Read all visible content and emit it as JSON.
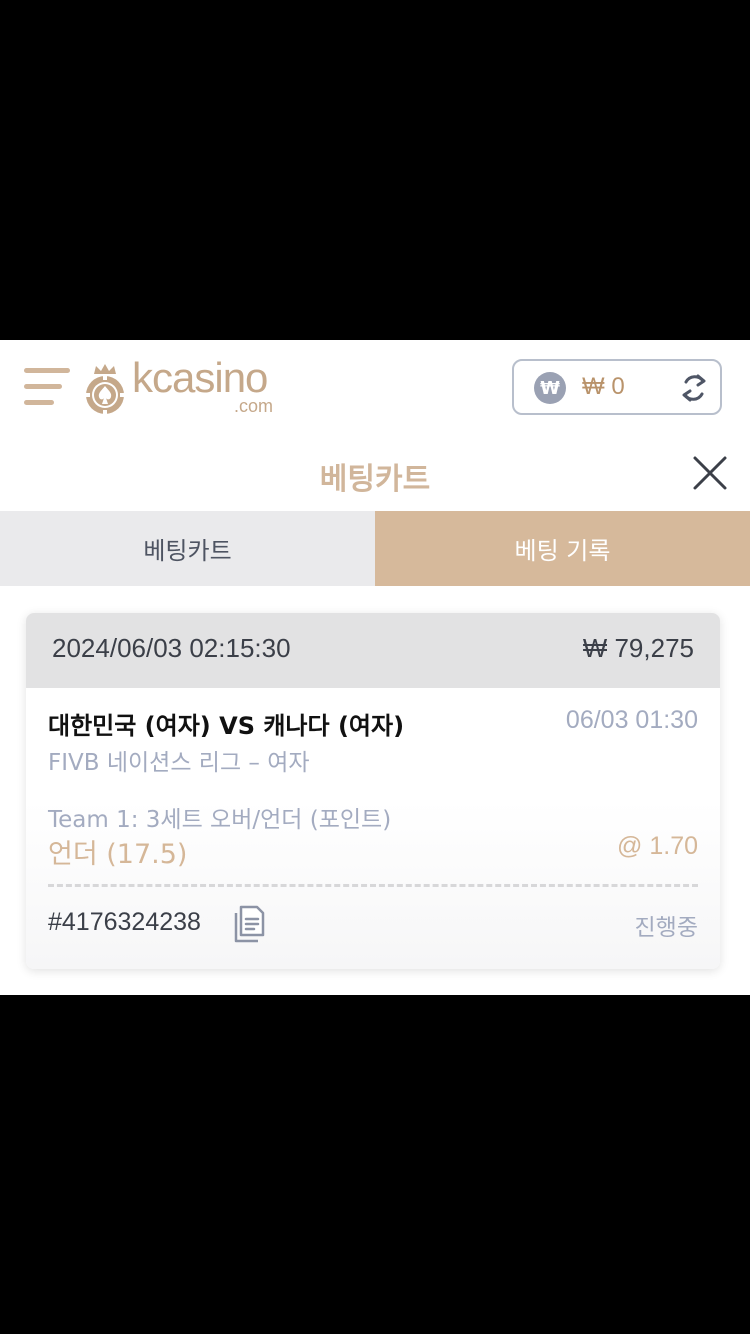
{
  "header": {
    "logo_text": "kcasino",
    "logo_sub": ".com",
    "wallet": {
      "currency_symbol": "₩",
      "balance": "₩ 0"
    }
  },
  "page": {
    "title": "베팅카트"
  },
  "tabs": [
    {
      "label": "베팅카트",
      "active": false
    },
    {
      "label": "베팅 기록",
      "active": true
    }
  ],
  "bet": {
    "datetime": "2024/06/03 02:15:30",
    "amount": "₩ 79,275",
    "match": "대한민국 (여자) VS 캐나다 (여자)",
    "match_time": "06/03 01:30",
    "league": "FIVB 네이션스 리그 – 여자",
    "market": "Team 1: 3세트 오버/언더 (포인트)",
    "pick": "언더 (17.5)",
    "odds": "@ 1.70",
    "ticket_id": "#4176324238",
    "status": "진행중"
  },
  "colors": {
    "accent": "#D6B99B",
    "muted": "#A3ABC0",
    "dark_text": "#3B3F48",
    "background": "#000000"
  },
  "icons": [
    "menu-icon",
    "casino-chip-icon",
    "won-icon",
    "refresh-icon",
    "close-icon",
    "copy-icon"
  ]
}
